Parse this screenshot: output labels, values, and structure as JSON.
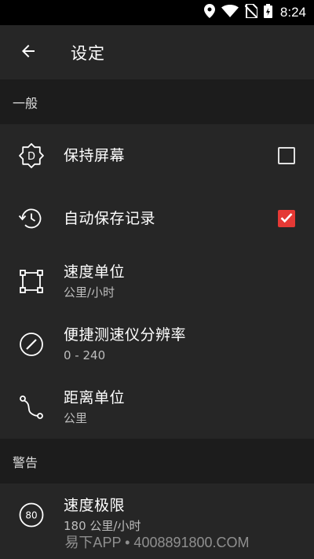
{
  "status_bar": {
    "time": "8:24"
  },
  "app_bar": {
    "title": "设定"
  },
  "sections": [
    {
      "label": "一般"
    },
    {
      "label": "警告"
    }
  ],
  "general": {
    "keep_screen": {
      "title": "保持屏幕",
      "checked": false
    },
    "auto_save": {
      "title": "自动保存记录",
      "checked": true
    },
    "speed_unit": {
      "title": "速度单位",
      "value": "公里/小时"
    },
    "speedometer_resolution": {
      "title": "便捷测速仪分辨率",
      "value": "0 - 240"
    },
    "distance_unit": {
      "title": "距离单位",
      "value": "公里"
    }
  },
  "warnings": {
    "speed_limit": {
      "title": "速度极限",
      "value": "180 公里/小时",
      "icon_text": "80"
    }
  },
  "watermark": "易下APP • 4008891800.COM",
  "colors": {
    "accent": "#e53935",
    "background": "#262626",
    "section_bg": "#1c1c1c"
  }
}
